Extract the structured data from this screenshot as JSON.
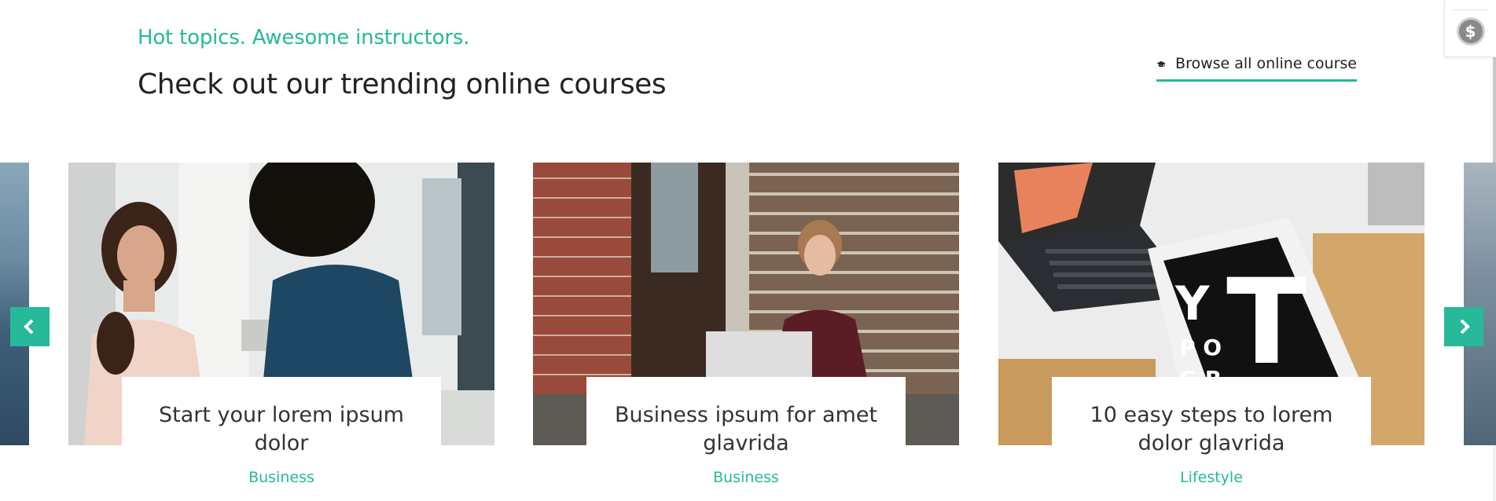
{
  "header": {
    "subtitle": "Hot topics. Awesome instructors.",
    "title": "Check out our trending online courses",
    "browse_label": "Browse all online course",
    "browse_icon": "graduation-cap-icon"
  },
  "side_widget": {
    "icon": "dollar-coin-icon"
  },
  "carousel": {
    "prev_icon": "chevron-left-icon",
    "next_icon": "chevron-right-icon",
    "cards": [
      {
        "title": "Start your lorem ipsum dolor",
        "category": "Business"
      },
      {
        "title": "Business ipsum for amet glavrida",
        "category": "Business"
      },
      {
        "title": "10 easy steps to lorem dolor glavrida",
        "category": "Lifestyle"
      }
    ]
  },
  "colors": {
    "accent": "#26b99a",
    "text": "#222222"
  }
}
